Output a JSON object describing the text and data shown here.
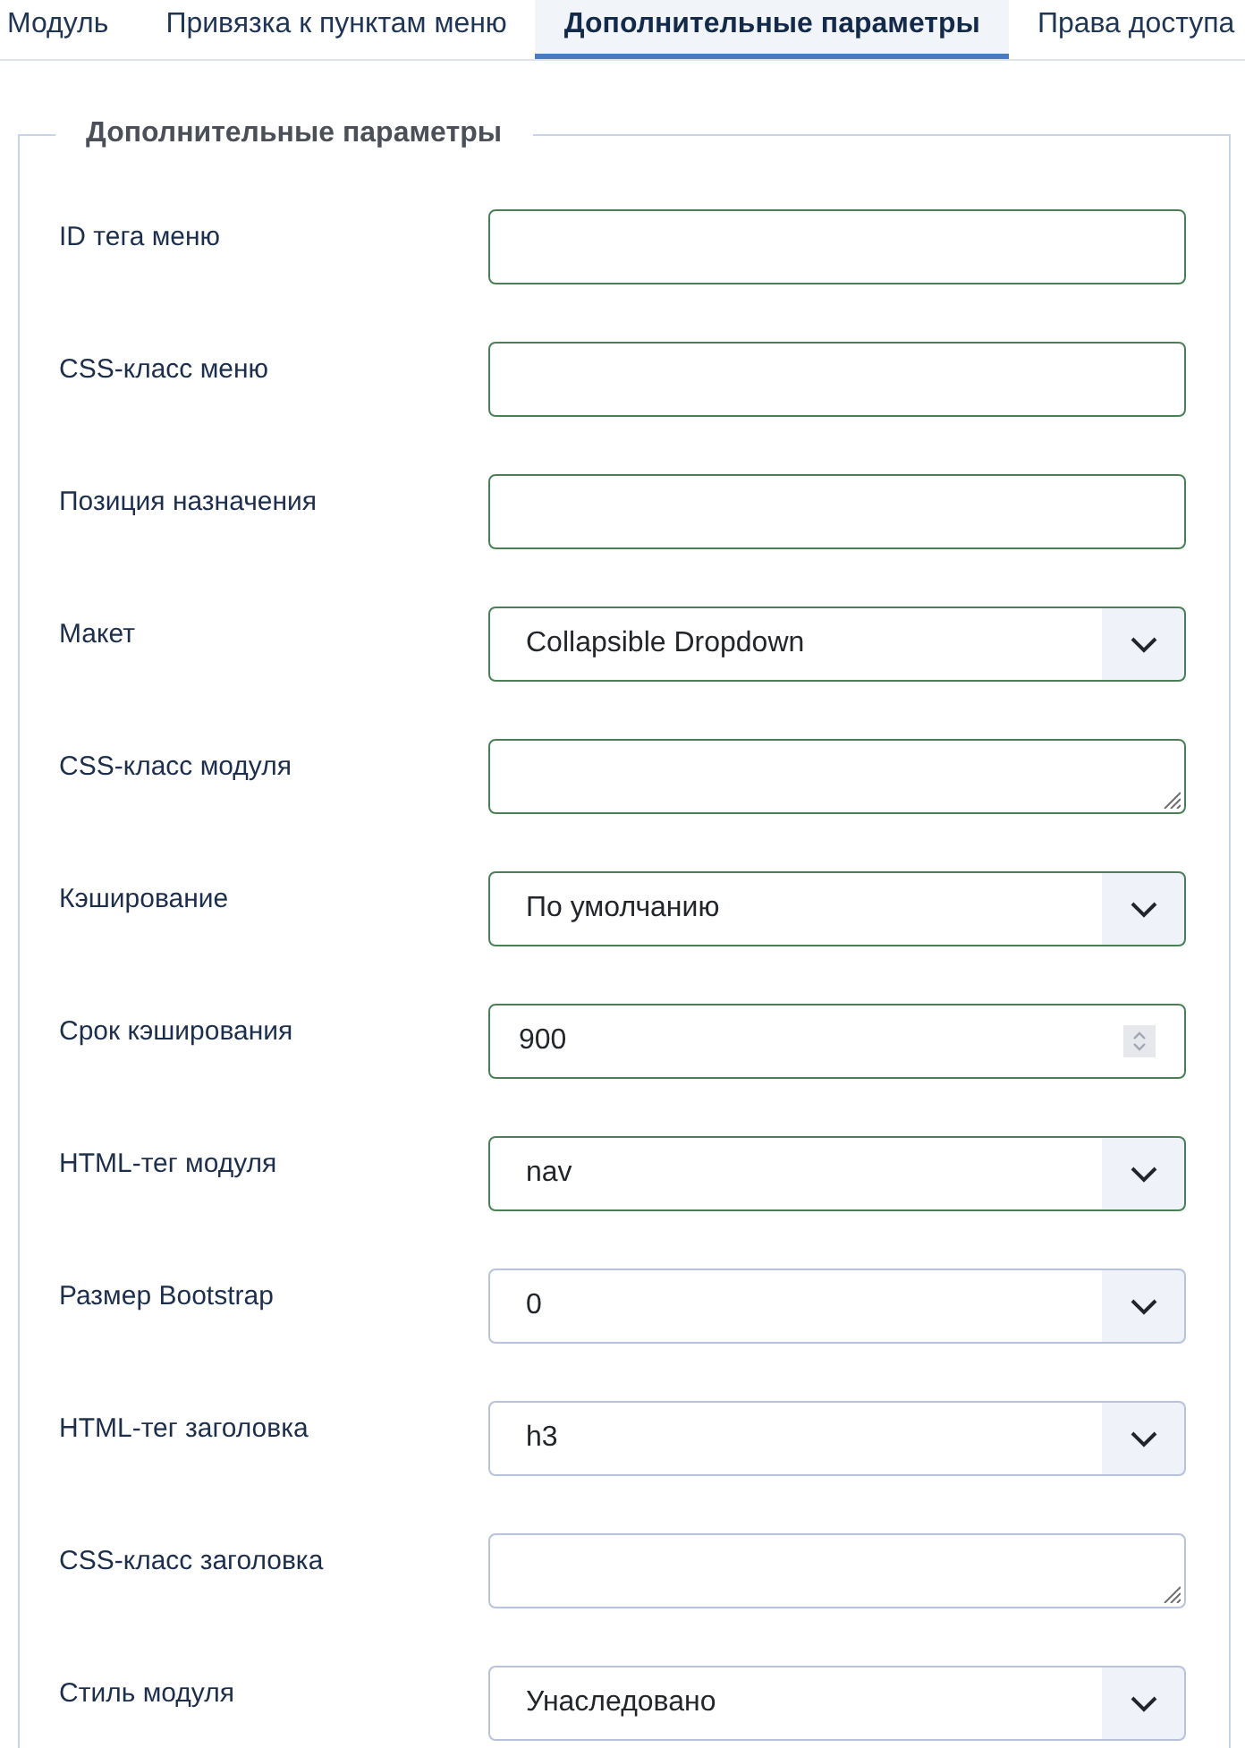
{
  "tabs": [
    {
      "label": "Модуль",
      "selected": false
    },
    {
      "label": "Привязка к пунктам меню",
      "selected": false
    },
    {
      "label": "Дополнительные параметры",
      "selected": true
    },
    {
      "label": "Права доступа",
      "selected": false
    }
  ],
  "fieldset": {
    "legend": "Дополнительные параметры",
    "fields": [
      {
        "label": "ID тега меню",
        "kind": "text",
        "valid": true
      },
      {
        "label": "CSS-класс меню",
        "kind": "text",
        "valid": true
      },
      {
        "label": "Позиция назначения",
        "kind": "text",
        "valid": true
      },
      {
        "label": "Макет",
        "kind": "select",
        "value": "Collapsible Dropdown",
        "valid": true
      },
      {
        "label": "CSS-класс модуля",
        "kind": "textarea",
        "valid": true
      },
      {
        "label": "Кэширование",
        "kind": "select",
        "value": "По умолчанию",
        "valid": true
      },
      {
        "label": "Срок кэширования",
        "kind": "number",
        "value": "900",
        "valid": true
      },
      {
        "label": "HTML-тег модуля",
        "kind": "select",
        "value": "nav",
        "valid": true
      },
      {
        "label": "Размер Bootstrap",
        "kind": "select",
        "value": "0",
        "valid": false
      },
      {
        "label": "HTML-тег заголовка",
        "kind": "select",
        "value": "h3",
        "valid": false
      },
      {
        "label": "CSS-класс заголовка",
        "kind": "textarea",
        "valid": false
      },
      {
        "label": "Стиль модуля",
        "kind": "select",
        "value": "Унаследовано",
        "valid": false
      }
    ]
  }
}
